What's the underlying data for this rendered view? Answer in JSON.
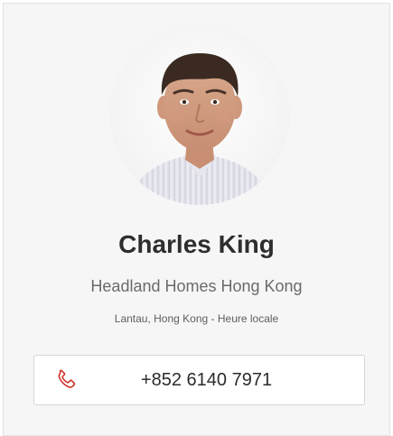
{
  "profile": {
    "name": "Charles King",
    "company": "Headland Homes Hong Kong",
    "location": "Lantau, Hong Kong - Heure locale"
  },
  "contact": {
    "phone": "+852 6140 7971",
    "phone_icon": "phone-icon",
    "icon_color": "#d0342c"
  }
}
